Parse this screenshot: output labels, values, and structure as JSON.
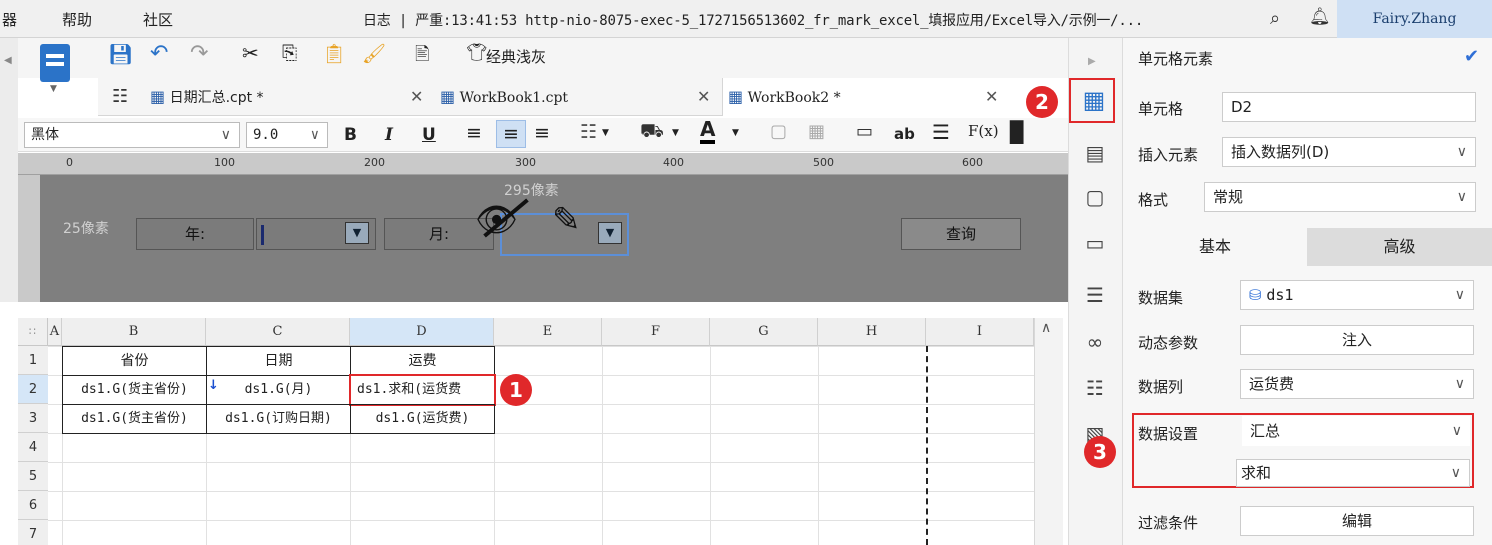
{
  "topbar": {
    "menu": [
      "器",
      "帮助",
      "社区"
    ],
    "log": "日志 | 严重:13:41:53 http-nio-8075-exec-5_1727156513602_fr_mark_excel_填报应用/Excel导入/示例一/...",
    "user": "Fairy.Zhang"
  },
  "toolbar": {
    "theme_label": "经典浅灰"
  },
  "tabs": [
    {
      "label": "日期汇总.cpt *"
    },
    {
      "label": "WorkBook1.cpt"
    },
    {
      "label": "WorkBook2 *"
    }
  ],
  "format": {
    "font": "黑体",
    "size": "9.0",
    "bold": "B",
    "italic": "I",
    "underline": "U"
  },
  "ruler": [
    "0",
    "100",
    "200",
    "300",
    "400",
    "500",
    "600"
  ],
  "canvas": {
    "px295": "295像素",
    "px25": "25像素",
    "year_label": "年:",
    "month_label": "月:",
    "query_button": "查询"
  },
  "grid": {
    "columns": [
      "A",
      "B",
      "C",
      "D",
      "E",
      "F",
      "G",
      "H",
      "I"
    ],
    "rows": [
      "1",
      "2",
      "3",
      "4",
      "5",
      "6",
      "7"
    ],
    "cells": {
      "B1": "省份",
      "C1": "日期",
      "D1": "运费",
      "B2": "ds1.G(货主省份)",
      "C2": "ds1.G(月)",
      "D2": "ds1.求和(运货费",
      "B3": "ds1.G(货主省份)",
      "C3": "ds1.G(订购日期)",
      "D3": "ds1.G(运货费)"
    }
  },
  "panel": {
    "title": "单元格元素",
    "cell_label": "单元格",
    "cell_value": "D2",
    "insert_label": "插入元素",
    "insert_value": "插入数据列(D)",
    "format_label": "格式",
    "format_value": "常规",
    "tab_basic": "基本",
    "tab_advanced": "高级",
    "dataset_label": "数据集",
    "dataset_value": "ds1",
    "dynparam_label": "动态参数",
    "dynparam_button": "注入",
    "column_label": "数据列",
    "column_value": "运货费",
    "setting_label": "数据设置",
    "setting_value": "汇总",
    "setting_sub": "求和",
    "filter_label": "过滤条件",
    "filter_button": "编辑"
  },
  "badges": [
    "1",
    "2",
    "3"
  ],
  "colors": {
    "accent": "#2f6fd6",
    "badge": "#e0282a",
    "selected_col": "#d5e6f7"
  }
}
